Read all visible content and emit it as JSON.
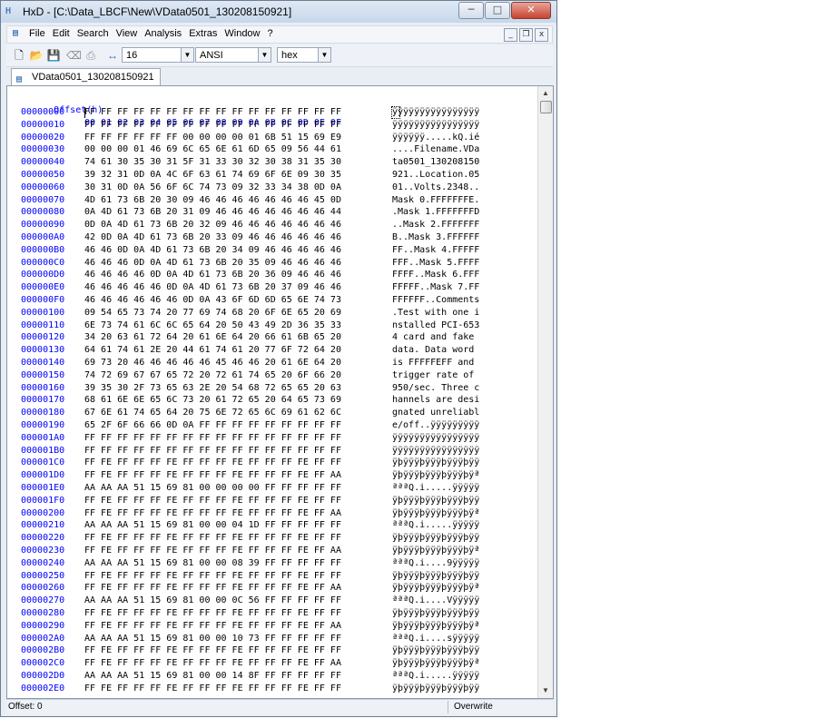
{
  "window": {
    "title": "HxD - [C:\\Data_LBCF\\New\\VData0501_130208150921]",
    "minimize": "─",
    "maximize": "□",
    "close": "✕"
  },
  "menu": {
    "items": [
      "File",
      "Edit",
      "Search",
      "View",
      "Analysis",
      "Extras",
      "Window",
      "?"
    ],
    "mdi": {
      "minimize": "_",
      "restore": "❐",
      "close": "x"
    }
  },
  "toolbar": {
    "icons": [
      "new-file-icon",
      "open-file-icon",
      "save-icon",
      "eraser-icon",
      "print-icon",
      "columns-icon"
    ],
    "columns": "16",
    "charset": "ANSI",
    "offset_base": "hex"
  },
  "tab": {
    "label": "VData0501_130208150921"
  },
  "editor": {
    "header_offset": "Offset(h)",
    "header_bytes": "00 01 02 03 04 05 06 07 08 09 0A 0B 0C 0D 0E 0F",
    "rows": [
      {
        "offset": "00000000",
        "hex": "FF FF FF FF FF FF FF FF FF FF FF FF FF FF FF FF",
        "ascii": "ÿÿÿÿÿÿÿÿÿÿÿÿÿÿÿÿ"
      },
      {
        "offset": "00000010",
        "hex": "FF FF FF FF FF FF FF FF FF FF FF FF FF FF FF FF",
        "ascii": "ÿÿÿÿÿÿÿÿÿÿÿÿÿÿÿÿ"
      },
      {
        "offset": "00000020",
        "hex": "FF FF FF FF FF FF 00 00 00 00 01 6B 51 15 69 E9",
        "ascii": "ÿÿÿÿÿÿ.....kQ.ié"
      },
      {
        "offset": "00000030",
        "hex": "00 00 00 01 46 69 6C 65 6E 61 6D 65 09 56 44 61",
        "ascii": "....Filename.VDa"
      },
      {
        "offset": "00000040",
        "hex": "74 61 30 35 30 31 5F 31 33 30 32 30 38 31 35 30",
        "ascii": "ta0501_130208150"
      },
      {
        "offset": "00000050",
        "hex": "39 32 31 0D 0A 4C 6F 63 61 74 69 6F 6E 09 30 35",
        "ascii": "921..Location.05"
      },
      {
        "offset": "00000060",
        "hex": "30 31 0D 0A 56 6F 6C 74 73 09 32 33 34 38 0D 0A",
        "ascii": "01..Volts.2348.."
      },
      {
        "offset": "00000070",
        "hex": "4D 61 73 6B 20 30 09 46 46 46 46 46 46 46 45 0D",
        "ascii": "Mask 0.FFFFFFFE."
      },
      {
        "offset": "00000080",
        "hex": "0A 4D 61 73 6B 20 31 09 46 46 46 46 46 46 46 44",
        "ascii": ".Mask 1.FFFFFFFD"
      },
      {
        "offset": "00000090",
        "hex": "0D 0A 4D 61 73 6B 20 32 09 46 46 46 46 46 46 46",
        "ascii": "..Mask 2.FFFFFFF"
      },
      {
        "offset": "000000A0",
        "hex": "42 0D 0A 4D 61 73 6B 20 33 09 46 46 46 46 46 46",
        "ascii": "B..Mask 3.FFFFFF"
      },
      {
        "offset": "000000B0",
        "hex": "46 46 0D 0A 4D 61 73 6B 20 34 09 46 46 46 46 46",
        "ascii": "FF..Mask 4.FFFFF"
      },
      {
        "offset": "000000C0",
        "hex": "46 46 46 0D 0A 4D 61 73 6B 20 35 09 46 46 46 46",
        "ascii": "FFF..Mask 5.FFFF"
      },
      {
        "offset": "000000D0",
        "hex": "46 46 46 46 0D 0A 4D 61 73 6B 20 36 09 46 46 46",
        "ascii": "FFFF..Mask 6.FFF"
      },
      {
        "offset": "000000E0",
        "hex": "46 46 46 46 46 0D 0A 4D 61 73 6B 20 37 09 46 46",
        "ascii": "FFFFF..Mask 7.FF"
      },
      {
        "offset": "000000F0",
        "hex": "46 46 46 46 46 46 0D 0A 43 6F 6D 6D 65 6E 74 73",
        "ascii": "FFFFFF..Comments"
      },
      {
        "offset": "00000100",
        "hex": "09 54 65 73 74 20 77 69 74 68 20 6F 6E 65 20 69",
        "ascii": ".Test with one i"
      },
      {
        "offset": "00000110",
        "hex": "6E 73 74 61 6C 6C 65 64 20 50 43 49 2D 36 35 33",
        "ascii": "nstalled PCI-653"
      },
      {
        "offset": "00000120",
        "hex": "34 20 63 61 72 64 20 61 6E 64 20 66 61 6B 65 20",
        "ascii": "4 card and fake "
      },
      {
        "offset": "00000130",
        "hex": "64 61 74 61 2E 20 44 61 74 61 20 77 6F 72 64 20",
        "ascii": "data. Data word "
      },
      {
        "offset": "00000140",
        "hex": "69 73 20 46 46 46 46 46 45 46 46 20 61 6E 64 20",
        "ascii": "is FFFFFEFF and "
      },
      {
        "offset": "00000150",
        "hex": "74 72 69 67 67 65 72 20 72 61 74 65 20 6F 66 20",
        "ascii": "trigger rate of "
      },
      {
        "offset": "00000160",
        "hex": "39 35 30 2F 73 65 63 2E 20 54 68 72 65 65 20 63",
        "ascii": "950/sec. Three c"
      },
      {
        "offset": "00000170",
        "hex": "68 61 6E 6E 65 6C 73 20 61 72 65 20 64 65 73 69",
        "ascii": "hannels are desi"
      },
      {
        "offset": "00000180",
        "hex": "67 6E 61 74 65 64 20 75 6E 72 65 6C 69 61 62 6C",
        "ascii": "gnated unreliabl"
      },
      {
        "offset": "00000190",
        "hex": "65 2F 6F 66 66 0D 0A FF FF FF FF FF FF FF FF FF",
        "ascii": "e/off..ÿÿÿÿÿÿÿÿÿ"
      },
      {
        "offset": "000001A0",
        "hex": "FF FF FF FF FF FF FF FF FF FF FF FF FF FF FF FF",
        "ascii": "ÿÿÿÿÿÿÿÿÿÿÿÿÿÿÿÿ"
      },
      {
        "offset": "000001B0",
        "hex": "FF FF FF FF FF FF FF FF FF FF FF FF FF FF FF FF",
        "ascii": "ÿÿÿÿÿÿÿÿÿÿÿÿÿÿÿÿ"
      },
      {
        "offset": "000001C0",
        "hex": "FF FE FF FF FF FE FF FF FF FE FF FF FF FE FF FF",
        "ascii": "ÿþÿÿÿþÿÿÿþÿÿÿþÿÿ"
      },
      {
        "offset": "000001D0",
        "hex": "FF FE FF FF FF FE FF FF FF FE FF FF FF FE FF AA",
        "ascii": "ÿþÿÿÿþÿÿÿþÿÿÿþÿª"
      },
      {
        "offset": "000001E0",
        "hex": "AA AA AA 51 15 69 81 00 00 00 00 FF FF FF FF FF",
        "ascii": "ªªªQ.i.....ÿÿÿÿÿ"
      },
      {
        "offset": "000001F0",
        "hex": "FF FE FF FF FF FE FF FF FF FE FF FF FF FE FF FF",
        "ascii": "ÿþÿÿÿþÿÿÿþÿÿÿþÿÿ"
      },
      {
        "offset": "00000200",
        "hex": "FF FE FF FF FF FE FF FF FF FE FF FF FF FE FF AA",
        "ascii": "ÿþÿÿÿþÿÿÿþÿÿÿþÿª"
      },
      {
        "offset": "00000210",
        "hex": "AA AA AA 51 15 69 81 00 00 04 1D FF FF FF FF FF",
        "ascii": "ªªªQ.i.....ÿÿÿÿÿ"
      },
      {
        "offset": "00000220",
        "hex": "FF FE FF FF FF FE FF FF FF FE FF FF FF FE FF FF",
        "ascii": "ÿþÿÿÿþÿÿÿþÿÿÿþÿÿ"
      },
      {
        "offset": "00000230",
        "hex": "FF FE FF FF FF FE FF FF FF FE FF FF FF FE FF AA",
        "ascii": "ÿþÿÿÿþÿÿÿþÿÿÿþÿª"
      },
      {
        "offset": "00000240",
        "hex": "AA AA AA 51 15 69 81 00 00 08 39 FF FF FF FF FF",
        "ascii": "ªªªQ.i....9ÿÿÿÿÿ"
      },
      {
        "offset": "00000250",
        "hex": "FF FE FF FF FF FE FF FF FF FE FF FF FF FE FF FF",
        "ascii": "ÿþÿÿÿþÿÿÿþÿÿÿþÿÿ"
      },
      {
        "offset": "00000260",
        "hex": "FF FE FF FF FF FE FF FF FF FE FF FF FF FE FF AA",
        "ascii": "ÿþÿÿÿþÿÿÿþÿÿÿþÿª"
      },
      {
        "offset": "00000270",
        "hex": "AA AA AA 51 15 69 81 00 00 0C 56 FF FF FF FF FF",
        "ascii": "ªªªQ.i....Vÿÿÿÿÿ"
      },
      {
        "offset": "00000280",
        "hex": "FF FE FF FF FF FE FF FF FF FE FF FF FF FE FF FF",
        "ascii": "ÿþÿÿÿþÿÿÿþÿÿÿþÿÿ"
      },
      {
        "offset": "00000290",
        "hex": "FF FE FF FF FF FE FF FF FF FE FF FF FF FE FF AA",
        "ascii": "ÿþÿÿÿþÿÿÿþÿÿÿþÿª"
      },
      {
        "offset": "000002A0",
        "hex": "AA AA AA 51 15 69 81 00 00 10 73 FF FF FF FF FF",
        "ascii": "ªªªQ.i....sÿÿÿÿÿ"
      },
      {
        "offset": "000002B0",
        "hex": "FF FE FF FF FF FE FF FF FF FE FF FF FF FE FF FF",
        "ascii": "ÿþÿÿÿþÿÿÿþÿÿÿþÿÿ"
      },
      {
        "offset": "000002C0",
        "hex": "FF FE FF FF FF FE FF FF FF FE FF FF FF FE FF AA",
        "ascii": "ÿþÿÿÿþÿÿÿþÿÿÿþÿª"
      },
      {
        "offset": "000002D0",
        "hex": "AA AA AA 51 15 69 81 00 00 14 8F FF FF FF FF FF",
        "ascii": "ªªªQ.i.....ÿÿÿÿÿ"
      },
      {
        "offset": "000002E0",
        "hex": "FF FE FF FF FF FE FF FF FF FE FF FF FF FE FF FF",
        "ascii": "ÿþÿÿÿþÿÿÿþÿÿÿþÿÿ"
      }
    ]
  },
  "status": {
    "offset": "Offset: 0",
    "mode": "Overwrite"
  },
  "colors": {
    "offset_blue": "#0000ff",
    "title_bg": "#c7d7ea",
    "close_red": "#c7432e"
  }
}
